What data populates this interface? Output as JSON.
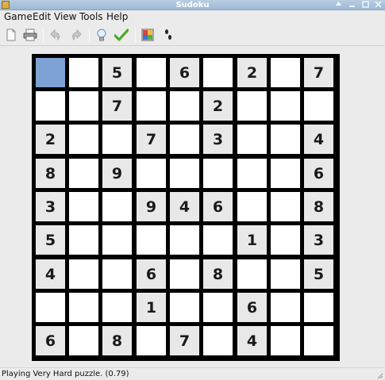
{
  "window": {
    "title": "Sudoku"
  },
  "menu": {
    "items": [
      {
        "label": "Game",
        "name": "menu-game"
      },
      {
        "label": "Edit",
        "name": "menu-edit"
      },
      {
        "label": "View",
        "name": "menu-view"
      },
      {
        "label": "Tools",
        "name": "menu-tools"
      },
      {
        "label": "Help",
        "name": "menu-help"
      }
    ]
  },
  "toolbar": {
    "buttons": [
      {
        "name": "new-game-button",
        "icon": "new-page-icon"
      },
      {
        "name": "print-button",
        "icon": "printer-icon"
      },
      {
        "name": "undo-button",
        "icon": "undo-icon"
      },
      {
        "name": "redo-button",
        "icon": "redo-icon"
      },
      {
        "name": "hint-button",
        "icon": "lightbulb-icon"
      },
      {
        "name": "check-button",
        "icon": "checkmark-icon"
      },
      {
        "name": "tracker-button",
        "icon": "color-grid-icon"
      },
      {
        "name": "notes-button",
        "icon": "footprints-icon"
      }
    ]
  },
  "board": {
    "selected": [
      0,
      0
    ],
    "grid": [
      [
        "",
        "",
        "5",
        "",
        "6",
        "",
        "2",
        "",
        "7"
      ],
      [
        "",
        "",
        "7",
        "",
        "",
        "2",
        "",
        "",
        ""
      ],
      [
        "2",
        "",
        "",
        "7",
        "",
        "3",
        "",
        "",
        "4"
      ],
      [
        "8",
        "",
        "9",
        "",
        "",
        "",
        "",
        "",
        "6"
      ],
      [
        "3",
        "",
        "",
        "9",
        "4",
        "6",
        "",
        "",
        "8"
      ],
      [
        "5",
        "",
        "",
        "",
        "",
        "",
        "1",
        "",
        "3"
      ],
      [
        "4",
        "",
        "",
        "6",
        "",
        "8",
        "",
        "",
        "5"
      ],
      [
        "",
        "",
        "",
        "1",
        "",
        "",
        "6",
        "",
        ""
      ],
      [
        "6",
        "",
        "8",
        "",
        "7",
        "",
        "4",
        "",
        ""
      ]
    ]
  },
  "status": {
    "text": "Playing Very Hard puzzle. (0.79)"
  },
  "colors": {
    "selected_cell": "#7fa2d4",
    "given_cell": "#e8e8e8",
    "empty_cell": "#ffffff",
    "grid_line": "#000000"
  }
}
